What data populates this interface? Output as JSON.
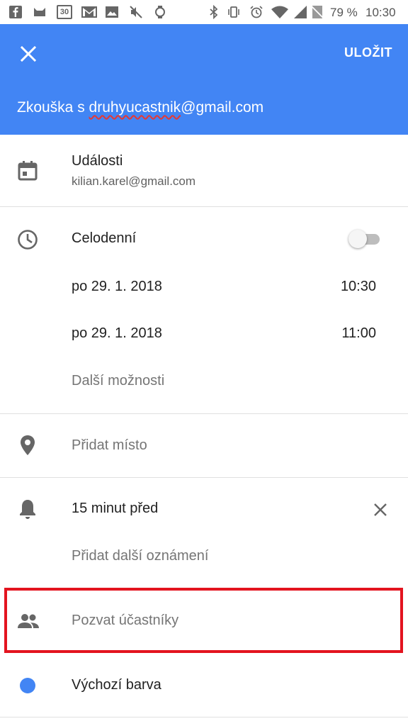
{
  "status_bar": {
    "battery_text": "79 %",
    "time": "10:30",
    "date_badge": "30"
  },
  "header": {
    "save_label": "ULOŽIT",
    "title_prefix": "Zkouška s ",
    "title_misspelled": "druhyucastnik",
    "title_suffix": "@gmail.com",
    "color": "#4285f4"
  },
  "calendar": {
    "label": "Události",
    "account": "kilian.karel@gmail.com"
  },
  "time_section": {
    "all_day_label": "Celodenní",
    "all_day_enabled": false,
    "start_date": "po 29. 1. 2018",
    "start_time": "10:30",
    "end_date": "po 29. 1. 2018",
    "end_time": "11:00",
    "more_options": "Další možnosti"
  },
  "location": {
    "placeholder": "Přidat místo"
  },
  "notifications": {
    "current": "15 minut před",
    "add_another": "Přidat další oznámení"
  },
  "guests": {
    "placeholder": "Pozvat účastníky"
  },
  "event_color": {
    "label": "Výchozí barva",
    "color": "#4285f4"
  }
}
